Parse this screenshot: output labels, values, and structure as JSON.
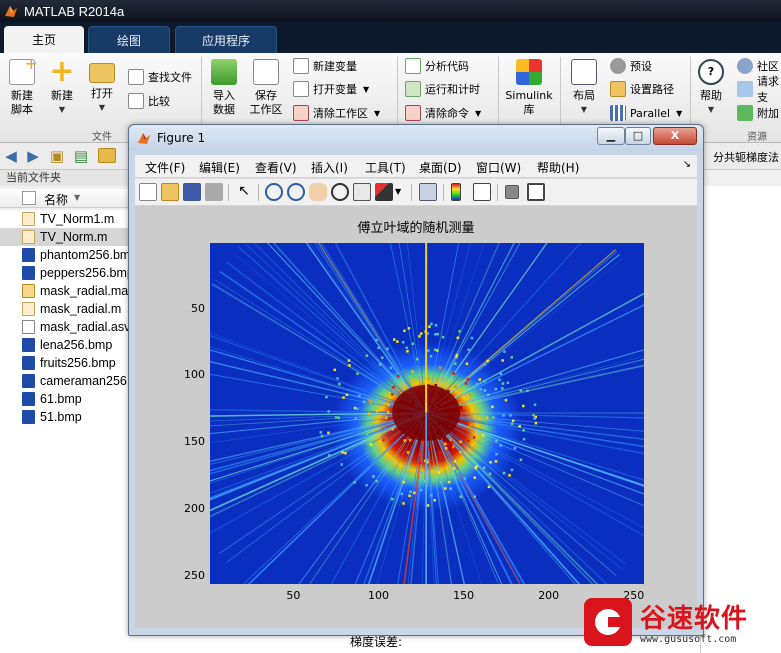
{
  "window": {
    "title": "MATLAB R2014a"
  },
  "tabs": [
    {
      "label": "主页",
      "active": true
    },
    {
      "label": "绘图",
      "active": false
    },
    {
      "label": "应用程序",
      "active": false
    }
  ],
  "ribbon": {
    "new_script": "新建\n脚本",
    "new": "新建",
    "open": "打开",
    "find_files": "查找文件",
    "compare": "比较",
    "group_file": "文件",
    "import_data": "导入\n数据",
    "save_workspace": "保存\n工作区",
    "new_variable": "新建变量",
    "open_variable": "打开变量",
    "clear_workspace": "清除工作区",
    "analyze_code": "分析代码",
    "run_and_time": "运行和计时",
    "clear_commands": "清除命令",
    "simulink": "Simulink\n库",
    "layout": "布局",
    "preferences": "预设",
    "set_path": "设置路径",
    "parallel": "Parallel",
    "help": "帮助",
    "community": "社区",
    "request_support": "请求支",
    "addons": "附加",
    "group_resources": "资源"
  },
  "address_bar": {
    "tail_text": "分共轭梯度法"
  },
  "current_folder": {
    "panel_title": "当前文件夹",
    "column_name": "名称",
    "files": [
      {
        "name": "TV_Norm1.m",
        "type": "m",
        "selected": false
      },
      {
        "name": "TV_Norm.m",
        "type": "m",
        "selected": true
      },
      {
        "name": "phantom256.bmp",
        "type": "bmp",
        "selected": false
      },
      {
        "name": "peppers256.bmp",
        "type": "bmp",
        "selected": false
      },
      {
        "name": "mask_radial.mat",
        "type": "mat",
        "selected": false
      },
      {
        "name": "mask_radial.m",
        "type": "m",
        "selected": false
      },
      {
        "name": "mask_radial.asv",
        "type": "asv",
        "selected": false
      },
      {
        "name": "lena256.bmp",
        "type": "bmp",
        "selected": false
      },
      {
        "name": "fruits256.bmp",
        "type": "bmp",
        "selected": false
      },
      {
        "name": "cameraman256.bmp",
        "type": "bmp",
        "selected": false
      },
      {
        "name": "61.bmp",
        "type": "bmp",
        "selected": false
      },
      {
        "name": "51.bmp",
        "type": "bmp",
        "selected": false
      }
    ]
  },
  "figure": {
    "title": "Figure 1",
    "minimize": "▁",
    "maximize": "□",
    "close": "X",
    "menus": [
      "文件(F)",
      "编辑(E)",
      "查看(V)",
      "插入(I)",
      "工具(T)",
      "桌面(D)",
      "窗口(W)",
      "帮助(H)"
    ],
    "menu_corner": "↘",
    "toolbar_icons": [
      "new-figure-icon",
      "open-file-icon",
      "save-icon",
      "print-icon",
      "pointer-icon",
      "zoom-in-icon",
      "zoom-out-icon",
      "pan-hand-icon",
      "rotate-3d-icon",
      "data-cursor-icon",
      "brush-icon",
      "link-plot-icon",
      "colorbar-icon",
      "legend-icon",
      "hide-plot-tools-icon",
      "show-plot-tools-icon"
    ]
  },
  "chart_data": {
    "type": "heatmap",
    "title": "傅立叶域的随机测量",
    "xlabel": "",
    "ylabel": "",
    "xlim": [
      1,
      256
    ],
    "ylim": [
      256,
      1
    ],
    "x_ticks": [
      50,
      100,
      150,
      200,
      250
    ],
    "y_ticks": [
      50,
      100,
      150,
      200,
      250
    ],
    "colormap": "jet",
    "center": [
      128,
      128
    ],
    "description_values": {
      "dense_center_radius": 20,
      "vertical_line_x": 128
    }
  },
  "bottom_panel": {
    "label": "梯度误差:"
  },
  "watermark": {
    "brand": "谷速软件",
    "url": "www.gususoft.com"
  },
  "colors": {
    "title_bar": "#0c121c",
    "tab_strip": "#0d1a2c",
    "active_tab": "#f2f2f2",
    "plot_background": "#0a2ec0",
    "plot_center": "#7a0000",
    "watermark_red": "#d9141c"
  }
}
